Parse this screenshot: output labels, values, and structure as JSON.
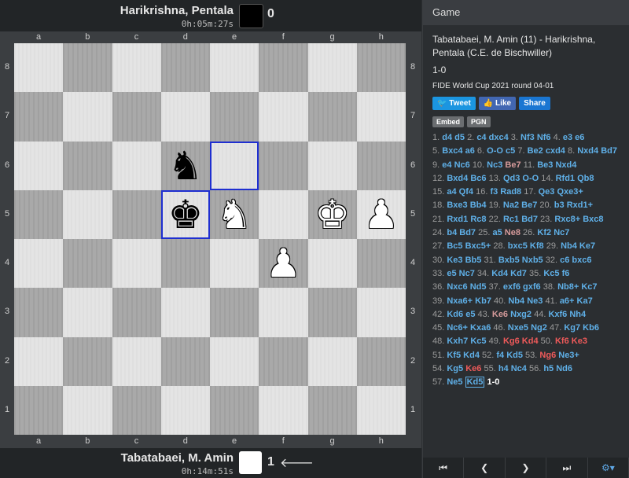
{
  "players": {
    "top": {
      "name": "Harikrishna, Pentala",
      "clock": "0h:05m:27s",
      "score": "0"
    },
    "bottom": {
      "name": "Tabatabaei, M. Amin",
      "clock": "0h:14m:51s",
      "score": "1",
      "turn_arrow": "🡐"
    }
  },
  "board": {
    "files": [
      "a",
      "b",
      "c",
      "d",
      "e",
      "f",
      "g",
      "h"
    ],
    "ranks": [
      "8",
      "7",
      "6",
      "5",
      "4",
      "3",
      "2",
      "1"
    ],
    "pieces": [
      {
        "square": "d6",
        "glyph": "♞",
        "color": "black"
      },
      {
        "square": "d5",
        "glyph": "♚",
        "color": "black"
      },
      {
        "square": "e5",
        "glyph": "♞",
        "color": "white"
      },
      {
        "square": "g5",
        "glyph": "♚",
        "color": "white"
      },
      {
        "square": "h5",
        "glyph": "♟",
        "color": "white"
      },
      {
        "square": "f4",
        "glyph": "♟",
        "color": "white"
      }
    ],
    "highlights": [
      "d5",
      "e6"
    ]
  },
  "panel": {
    "header": "Game",
    "title": "Tabatabaei, M. Amin (11) - Harikrishna, Pentala (C.E. de Bischwiller)",
    "result": "1-0",
    "event": "FIDE World Cup 2021 round 04-01",
    "share": {
      "tweet": "🐦 Tweet",
      "like": "👍 Like",
      "share": "Share"
    },
    "tools": {
      "embed": "Embed",
      "pgn": "PGN"
    }
  },
  "moves": [
    [
      [
        "n",
        "1."
      ],
      [
        "m",
        "d4"
      ],
      [
        "m",
        "d5"
      ],
      [
        "n",
        "2."
      ],
      [
        "m",
        "c4"
      ],
      [
        "m",
        "dxc4"
      ],
      [
        "n",
        "3."
      ],
      [
        "m",
        "Nf3"
      ],
      [
        "m",
        "Nf6"
      ],
      [
        "n",
        "4."
      ],
      [
        "m",
        "e3"
      ],
      [
        "m",
        "e6"
      ]
    ],
    [
      [
        "n",
        "5."
      ],
      [
        "m",
        "Bxc4"
      ],
      [
        "m",
        "a6"
      ],
      [
        "n",
        "6."
      ],
      [
        "m",
        "O-O"
      ],
      [
        "m",
        "c5"
      ],
      [
        "n",
        "7."
      ],
      [
        "m",
        "Be2"
      ],
      [
        "m",
        "cxd4"
      ],
      [
        "n",
        "8."
      ],
      [
        "m",
        "Nxd4"
      ],
      [
        "m",
        "Bd7"
      ]
    ],
    [
      [
        "n",
        "9."
      ],
      [
        "m",
        "e4"
      ],
      [
        "m",
        "Nc6"
      ],
      [
        "n",
        "10."
      ],
      [
        "m",
        "Nc3"
      ],
      [
        "p",
        "Be7"
      ],
      [
        "n",
        "11."
      ],
      [
        "m",
        "Be3"
      ],
      [
        "m",
        "Nxd4"
      ]
    ],
    [
      [
        "n",
        "12."
      ],
      [
        "m",
        "Bxd4"
      ],
      [
        "m",
        "Bc6"
      ],
      [
        "n",
        "13."
      ],
      [
        "m",
        "Qd3"
      ],
      [
        "m",
        "O-O"
      ],
      [
        "n",
        "14."
      ],
      [
        "m",
        "Rfd1"
      ],
      [
        "m",
        "Qb8"
      ]
    ],
    [
      [
        "n",
        "15."
      ],
      [
        "m",
        "a4"
      ],
      [
        "m",
        "Qf4"
      ],
      [
        "n",
        "16."
      ],
      [
        "m",
        "f3"
      ],
      [
        "m",
        "Rad8"
      ],
      [
        "n",
        "17."
      ],
      [
        "m",
        "Qe3"
      ],
      [
        "m",
        "Qxe3+"
      ]
    ],
    [
      [
        "n",
        "18."
      ],
      [
        "m",
        "Bxe3"
      ],
      [
        "m",
        "Bb4"
      ],
      [
        "n",
        "19."
      ],
      [
        "m",
        "Na2"
      ],
      [
        "m",
        "Be7"
      ],
      [
        "n",
        "20."
      ],
      [
        "m",
        "b3"
      ],
      [
        "m",
        "Rxd1+"
      ]
    ],
    [
      [
        "n",
        "21."
      ],
      [
        "m",
        "Rxd1"
      ],
      [
        "m",
        "Rc8"
      ],
      [
        "n",
        "22."
      ],
      [
        "m",
        "Rc1"
      ],
      [
        "m",
        "Bd7"
      ],
      [
        "n",
        "23."
      ],
      [
        "m",
        "Rxc8+"
      ],
      [
        "m",
        "Bxc8"
      ]
    ],
    [
      [
        "n",
        "24."
      ],
      [
        "m",
        "b4"
      ],
      [
        "m",
        "Bd7"
      ],
      [
        "n",
        "25."
      ],
      [
        "m",
        "a5"
      ],
      [
        "p",
        "Ne8"
      ],
      [
        "n",
        "26."
      ],
      [
        "m",
        "Kf2"
      ],
      [
        "m",
        "Nc7"
      ]
    ],
    [
      [
        "n",
        "27."
      ],
      [
        "m",
        "Bc5"
      ],
      [
        "m",
        "Bxc5+"
      ],
      [
        "n",
        "28."
      ],
      [
        "m",
        "bxc5"
      ],
      [
        "m",
        "Kf8"
      ],
      [
        "n",
        "29."
      ],
      [
        "m",
        "Nb4"
      ],
      [
        "m",
        "Ke7"
      ]
    ],
    [
      [
        "n",
        "30."
      ],
      [
        "m",
        "Ke3"
      ],
      [
        "m",
        "Bb5"
      ],
      [
        "n",
        "31."
      ],
      [
        "m",
        "Bxb5"
      ],
      [
        "m",
        "Nxb5"
      ],
      [
        "n",
        "32."
      ],
      [
        "m",
        "c6"
      ],
      [
        "m",
        "bxc6"
      ]
    ],
    [
      [
        "n",
        "33."
      ],
      [
        "m",
        "e5"
      ],
      [
        "m",
        "Nc7"
      ],
      [
        "n",
        "34."
      ],
      [
        "m",
        "Kd4"
      ],
      [
        "m",
        "Kd7"
      ],
      [
        "n",
        "35."
      ],
      [
        "m",
        "Kc5"
      ],
      [
        "m",
        "f6"
      ]
    ],
    [
      [
        "n",
        "36."
      ],
      [
        "m",
        "Nxc6"
      ],
      [
        "m",
        "Nd5"
      ],
      [
        "n",
        "37."
      ],
      [
        "m",
        "exf6"
      ],
      [
        "m",
        "gxf6"
      ],
      [
        "n",
        "38."
      ],
      [
        "m",
        "Nb8+"
      ],
      [
        "m",
        "Kc7"
      ]
    ],
    [
      [
        "n",
        "39."
      ],
      [
        "m",
        "Nxa6+"
      ],
      [
        "m",
        "Kb7"
      ],
      [
        "n",
        "40."
      ],
      [
        "m",
        "Nb4"
      ],
      [
        "m",
        "Ne3"
      ],
      [
        "n",
        "41."
      ],
      [
        "m",
        "a6+"
      ],
      [
        "m",
        "Ka7"
      ]
    ],
    [
      [
        "n",
        "42."
      ],
      [
        "m",
        "Kd6"
      ],
      [
        "m",
        "e5"
      ],
      [
        "n",
        "43."
      ],
      [
        "p",
        "Ke6"
      ],
      [
        "m",
        "Nxg2"
      ],
      [
        "n",
        "44."
      ],
      [
        "m",
        "Kxf6"
      ],
      [
        "m",
        "Nh4"
      ]
    ],
    [
      [
        "n",
        "45."
      ],
      [
        "m",
        "Nc6+"
      ],
      [
        "m",
        "Kxa6"
      ],
      [
        "n",
        "46."
      ],
      [
        "m",
        "Nxe5"
      ],
      [
        "m",
        "Ng2"
      ],
      [
        "n",
        "47."
      ],
      [
        "m",
        "Kg7"
      ],
      [
        "m",
        "Kb6"
      ]
    ],
    [
      [
        "n",
        "48."
      ],
      [
        "m",
        "Kxh7"
      ],
      [
        "m",
        "Kc5"
      ],
      [
        "n",
        "49."
      ],
      [
        "r",
        "Kg6"
      ],
      [
        "r",
        "Kd4"
      ],
      [
        "n",
        "50."
      ],
      [
        "r",
        "Kf6"
      ],
      [
        "r",
        "Ke3"
      ]
    ],
    [
      [
        "n",
        "51."
      ],
      [
        "m",
        "Kf5"
      ],
      [
        "m",
        "Kd4"
      ],
      [
        "n",
        "52."
      ],
      [
        "m",
        "f4"
      ],
      [
        "m",
        "Kd5"
      ],
      [
        "n",
        "53."
      ],
      [
        "r",
        "Ng6"
      ],
      [
        "m",
        "Ne3+"
      ]
    ],
    [
      [
        "n",
        "54."
      ],
      [
        "m",
        "Kg5"
      ],
      [
        "r",
        "Ke6"
      ],
      [
        "n",
        "55."
      ],
      [
        "m",
        "h4"
      ],
      [
        "m",
        "Nc4"
      ],
      [
        "n",
        "56."
      ],
      [
        "m",
        "h5"
      ],
      [
        "m",
        "Nd6"
      ]
    ],
    [
      [
        "n",
        "57."
      ],
      [
        "m",
        "Ne5"
      ],
      [
        "c",
        "Kd5"
      ],
      [
        "w",
        "1-0"
      ]
    ]
  ],
  "nav": {
    "first": "⏮",
    "prev": "❮",
    "next": "❯",
    "last": "⏭",
    "settings": "⚙▾"
  }
}
